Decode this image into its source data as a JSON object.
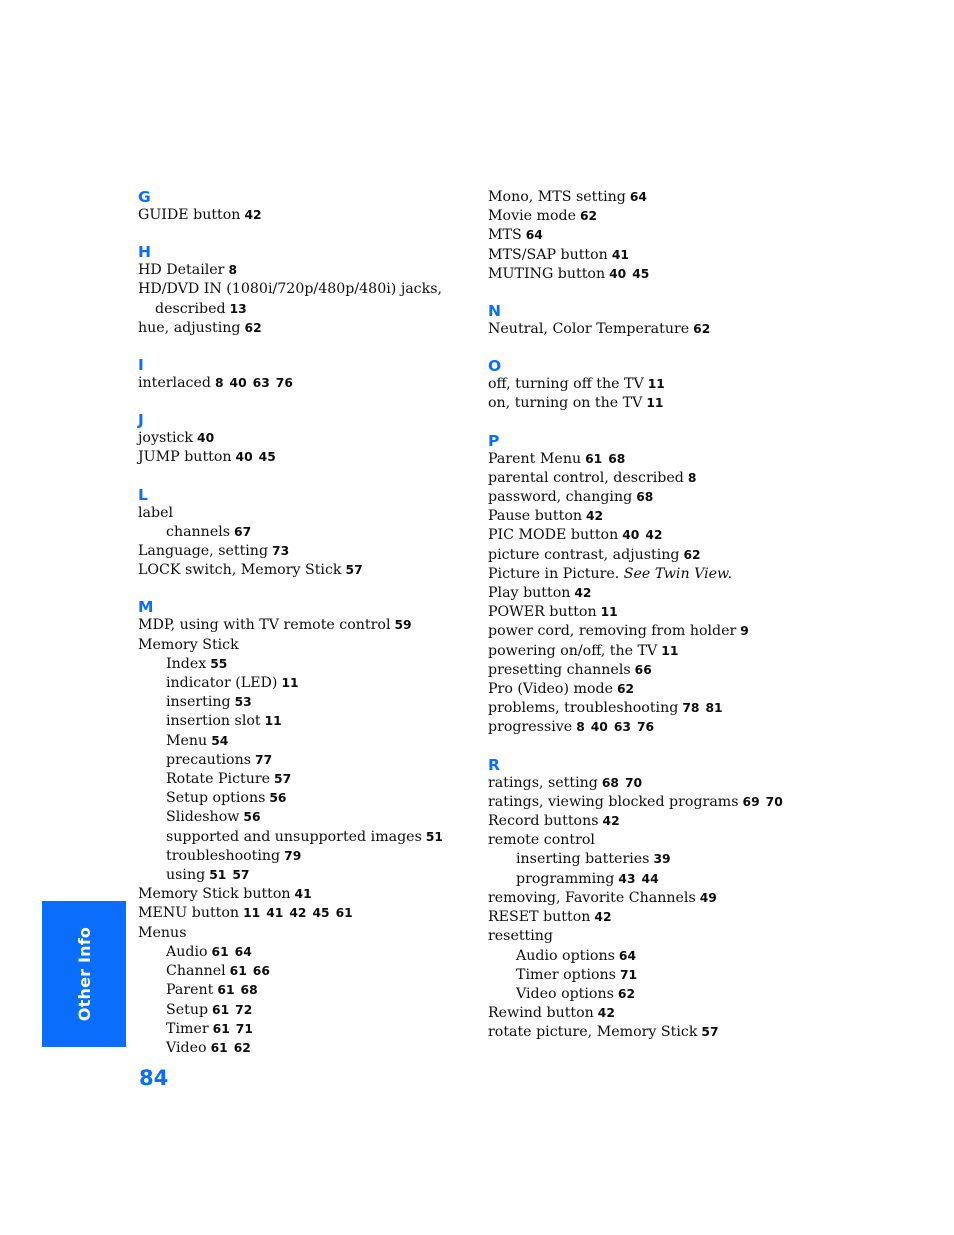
{
  "page": {
    "folio": "84",
    "thumb_tab_label": "Other Info",
    "accent_color": "#0a6efa",
    "text_color": "#0d0d0d"
  },
  "columns": [
    {
      "id": "left",
      "sections": [
        {
          "letter": "G",
          "entries": [
            {
              "level": 1,
              "term": "GUIDE button",
              "pages": [
                "42"
              ]
            }
          ]
        },
        {
          "letter": "H",
          "entries": [
            {
              "level": 1,
              "term": "HD Detailer",
              "pages": [
                "8"
              ]
            },
            {
              "level": 1,
              "term": "HD/DVD IN (1080i/720p/480p/480i) jacks,",
              "pages": []
            },
            {
              "level": "cont",
              "term": "described",
              "pages": [
                "13"
              ]
            },
            {
              "level": 1,
              "term": "hue, adjusting",
              "pages": [
                "62"
              ]
            }
          ]
        },
        {
          "letter": "I",
          "entries": [
            {
              "level": 1,
              "term": "interlaced",
              "pages": [
                "8",
                "40",
                "63",
                "76"
              ]
            }
          ]
        },
        {
          "letter": "J",
          "entries": [
            {
              "level": 1,
              "term": "joystick",
              "pages": [
                "40"
              ]
            },
            {
              "level": 1,
              "term": "JUMP button",
              "pages": [
                "40",
                "45"
              ]
            }
          ]
        },
        {
          "letter": "L",
          "entries": [
            {
              "level": 1,
              "term": "label",
              "pages": []
            },
            {
              "level": 2,
              "term": "channels",
              "pages": [
                "67"
              ]
            },
            {
              "level": 1,
              "term": "Language, setting",
              "pages": [
                "73"
              ]
            },
            {
              "level": 1,
              "term": "LOCK switch, Memory Stick",
              "pages": [
                "57"
              ]
            }
          ]
        },
        {
          "letter": "M",
          "entries": [
            {
              "level": 1,
              "term": "MDP, using with TV remote control",
              "pages": [
                "59"
              ]
            },
            {
              "level": 1,
              "term": "Memory Stick",
              "pages": []
            },
            {
              "level": 2,
              "term": "Index",
              "pages": [
                "55"
              ]
            },
            {
              "level": 2,
              "term": "indicator (LED)",
              "pages": [
                "11"
              ]
            },
            {
              "level": 2,
              "term": "inserting",
              "pages": [
                "53"
              ]
            },
            {
              "level": 2,
              "term": "insertion slot",
              "pages": [
                "11"
              ]
            },
            {
              "level": 2,
              "term": "Menu",
              "pages": [
                "54"
              ]
            },
            {
              "level": 2,
              "term": "precautions",
              "pages": [
                "77"
              ]
            },
            {
              "level": 2,
              "term": "Rotate Picture",
              "pages": [
                "57"
              ]
            },
            {
              "level": 2,
              "term": "Setup options",
              "pages": [
                "56"
              ]
            },
            {
              "level": 2,
              "term": "Slideshow",
              "pages": [
                "56"
              ]
            },
            {
              "level": 2,
              "term": "supported and unsupported images",
              "pages": [
                "51"
              ]
            },
            {
              "level": 2,
              "term": "troubleshooting",
              "pages": [
                "79"
              ]
            },
            {
              "level": 2,
              "term": "using",
              "pages": [
                "51",
                "57"
              ]
            },
            {
              "level": 1,
              "term": "Memory Stick button",
              "pages": [
                "41"
              ]
            },
            {
              "level": 1,
              "term": "MENU button",
              "pages": [
                "11",
                "41",
                "42",
                "45",
                "61"
              ]
            },
            {
              "level": 1,
              "term": "Menus",
              "pages": []
            },
            {
              "level": 2,
              "term": "Audio",
              "pages": [
                "61",
                "64"
              ]
            },
            {
              "level": 2,
              "term": "Channel",
              "pages": [
                "61",
                "66"
              ]
            },
            {
              "level": 2,
              "term": "Parent",
              "pages": [
                "61",
                "68"
              ]
            },
            {
              "level": 2,
              "term": "Setup",
              "pages": [
                "61",
                "72"
              ]
            },
            {
              "level": 2,
              "term": "Timer",
              "pages": [
                "61",
                "71"
              ]
            },
            {
              "level": 2,
              "term": "Video",
              "pages": [
                "61",
                "62"
              ]
            }
          ]
        }
      ]
    },
    {
      "id": "right",
      "sections": [
        {
          "letter": "",
          "entries": [
            {
              "level": 1,
              "term": "Mono, MTS setting",
              "pages": [
                "64"
              ]
            },
            {
              "level": 1,
              "term": "Movie mode",
              "pages": [
                "62"
              ]
            },
            {
              "level": 1,
              "term": "MTS",
              "pages": [
                "64"
              ]
            },
            {
              "level": 1,
              "term": "MTS/SAP button",
              "pages": [
                "41"
              ]
            },
            {
              "level": 1,
              "term": "MUTING button",
              "pages": [
                "40",
                "45"
              ]
            }
          ]
        },
        {
          "letter": "N",
          "entries": [
            {
              "level": 1,
              "term": "Neutral, Color Temperature",
              "pages": [
                "62"
              ]
            }
          ]
        },
        {
          "letter": "O",
          "entries": [
            {
              "level": 1,
              "term": "off, turning off the TV",
              "pages": [
                "11"
              ]
            },
            {
              "level": 1,
              "term": "on, turning on the TV",
              "pages": [
                "11"
              ]
            }
          ]
        },
        {
          "letter": "P",
          "entries": [
            {
              "level": 1,
              "term": "Parent Menu",
              "pages": [
                "61",
                "68"
              ]
            },
            {
              "level": 1,
              "term": "parental control, described",
              "pages": [
                "8"
              ]
            },
            {
              "level": 1,
              "term": "password, changing",
              "pages": [
                "68"
              ]
            },
            {
              "level": 1,
              "term": "Pause button",
              "pages": [
                "42"
              ]
            },
            {
              "level": 1,
              "term": "PIC MODE button",
              "pages": [
                "40",
                "42"
              ]
            },
            {
              "level": 1,
              "term": "picture contrast, adjusting",
              "pages": [
                "62"
              ]
            },
            {
              "level": 1,
              "term": "Picture in Picture.",
              "term_italic": "See Twin View.",
              "pages": []
            },
            {
              "level": 1,
              "term": "Play button",
              "pages": [
                "42"
              ]
            },
            {
              "level": 1,
              "term": "POWER button",
              "pages": [
                "11"
              ]
            },
            {
              "level": 1,
              "term": "power cord, removing from holder",
              "pages": [
                "9"
              ]
            },
            {
              "level": 1,
              "term": "powering on/off, the TV",
              "pages": [
                "11"
              ]
            },
            {
              "level": 1,
              "term": "presetting channels",
              "pages": [
                "66"
              ]
            },
            {
              "level": 1,
              "term": "Pro (Video) mode",
              "pages": [
                "62"
              ]
            },
            {
              "level": 1,
              "term": "problems, troubleshooting",
              "pages": [
                "78",
                "81"
              ]
            },
            {
              "level": 1,
              "term": "progressive",
              "pages": [
                "8",
                "40",
                "63",
                "76"
              ]
            }
          ]
        },
        {
          "letter": "R",
          "entries": [
            {
              "level": 1,
              "term": "ratings, setting",
              "pages": [
                "68",
                "70"
              ]
            },
            {
              "level": 1,
              "term": "ratings, viewing blocked programs",
              "pages": [
                "69",
                "70"
              ]
            },
            {
              "level": 1,
              "term": "Record buttons",
              "pages": [
                "42"
              ]
            },
            {
              "level": 1,
              "term": "remote control",
              "pages": []
            },
            {
              "level": 2,
              "term": "inserting batteries",
              "pages": [
                "39"
              ]
            },
            {
              "level": 2,
              "term": "programming",
              "pages": [
                "43",
                "44"
              ]
            },
            {
              "level": 1,
              "term": "removing, Favorite Channels",
              "pages": [
                "49"
              ]
            },
            {
              "level": 1,
              "term": "RESET button",
              "pages": [
                "42"
              ]
            },
            {
              "level": 1,
              "term": "resetting",
              "pages": []
            },
            {
              "level": 2,
              "term": "Audio options",
              "pages": [
                "64"
              ]
            },
            {
              "level": 2,
              "term": "Timer options",
              "pages": [
                "71"
              ]
            },
            {
              "level": 2,
              "term": "Video options",
              "pages": [
                "62"
              ]
            },
            {
              "level": 1,
              "term": "Rewind button",
              "pages": [
                "42"
              ]
            },
            {
              "level": 1,
              "term": "rotate picture, Memory Stick",
              "pages": [
                "57"
              ]
            }
          ]
        }
      ]
    }
  ]
}
